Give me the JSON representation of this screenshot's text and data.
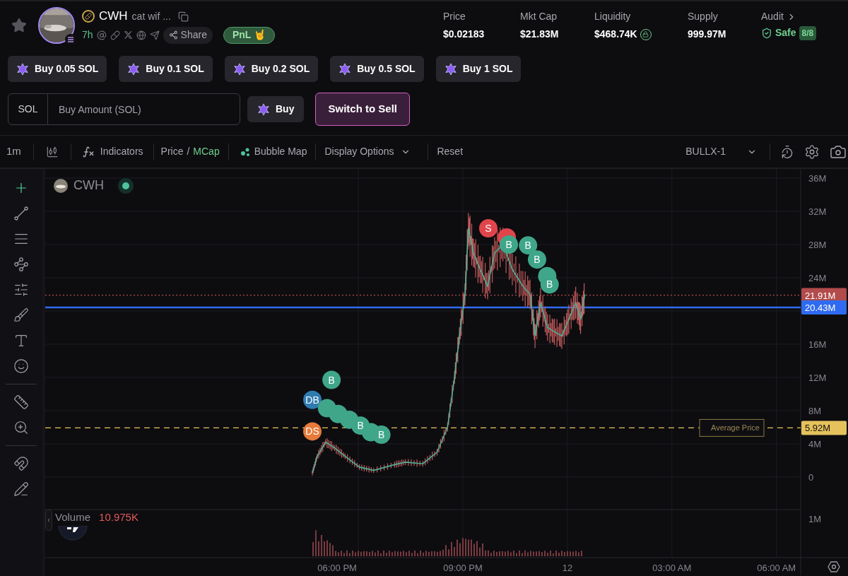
{
  "header": {
    "symbol": "CWH",
    "name": "cat wif ...",
    "age": "7h",
    "share": "Share",
    "pnl": "PnL 🤘"
  },
  "stats": [
    {
      "label": "Price",
      "value": "$0.02183"
    },
    {
      "label": "Mkt Cap",
      "value": "$21.83M"
    },
    {
      "label": "Liquidity",
      "value": "$468.74K",
      "locked": true
    },
    {
      "label": "Supply",
      "value": "999.97M"
    }
  ],
  "audit": {
    "label": "Audit",
    "status": "Safe",
    "score": "8/8"
  },
  "quick_buys": [
    "Buy 0.05 SOL",
    "Buy 0.1 SOL",
    "Buy 0.2 SOL",
    "Buy 0.5 SOL",
    "Buy 1 SOL"
  ],
  "order": {
    "currency": "SOL",
    "placeholder": "Buy Amount (SOL)",
    "buy": "Buy",
    "switch": "Switch to Sell"
  },
  "toolbar": {
    "interval": "1m",
    "indicators": "Indicators",
    "modes": [
      {
        "label": "Price",
        "selected": false
      },
      {
        "label": "MCap",
        "selected": true
      }
    ],
    "separator": "/",
    "bubble_map": "Bubble Map",
    "display_options": "Display Options",
    "reset": "Reset",
    "layout": "BULLX-1"
  },
  "tool_groups": [
    [
      {
        "kind": "crosshair",
        "selected": true
      },
      {
        "kind": "trend",
        "selected": false
      },
      {
        "kind": "hlines",
        "selected": false
      },
      {
        "kind": "pattern",
        "selected": false
      },
      {
        "kind": "fib",
        "selected": false
      },
      {
        "kind": "brush",
        "selected": false
      },
      {
        "kind": "text",
        "selected": false
      },
      {
        "kind": "emoji",
        "selected": false
      }
    ],
    [
      {
        "kind": "ruler",
        "selected": false
      },
      {
        "kind": "zoom",
        "selected": false
      }
    ],
    [
      {
        "kind": "magnet",
        "selected": false
      },
      {
        "kind": "lock",
        "selected": false
      }
    ]
  ],
  "chart": {
    "legend": "CWH",
    "volume_label": "Volume",
    "volume_value": "10.975K",
    "y_axis": [
      "36M",
      "32M",
      "28M",
      "24M",
      "16M",
      "12M",
      "8M",
      "4M",
      "0"
    ],
    "volume_axis": "1M",
    "time_axis": [
      "06:00 PM",
      "09:00 PM",
      "12",
      "03:00 AM",
      "06:00 AM"
    ],
    "price_tags": [
      {
        "kind": "last",
        "label": "21.91M",
        "color": "#b24b4b"
      },
      {
        "kind": "position",
        "label": "20.43M",
        "color": "#2f6bf0"
      },
      {
        "kind": "average",
        "label": "5.92M",
        "note": "Average Price",
        "color": "#e6c25c"
      }
    ],
    "markers": [
      {
        "text": "S",
        "color": "#e0454b"
      },
      {
        "color": "#e0454b"
      },
      {
        "text": "B",
        "color": "#3fa68a"
      },
      {
        "text": "B",
        "color": "#3fa68a"
      },
      {
        "text": "B",
        "color": "#3fa68a"
      },
      {
        "color": "#3fa68a"
      },
      {
        "text": "B",
        "color": "#3fa68a"
      },
      {
        "text": "B",
        "color": "#3fa68a"
      },
      {
        "text": "DB",
        "color": "#2f7bb0"
      },
      {
        "text": "DS",
        "color": "#e57a3a"
      },
      {
        "color": "#3fa68a"
      },
      {
        "color": "#3fa68a"
      },
      {
        "color": "#3fa68a"
      },
      {
        "text": "B",
        "color": "#3fa68a"
      },
      {
        "color": "#3fa68a"
      },
      {
        "text": "B",
        "color": "#3fa68a"
      }
    ]
  }
}
